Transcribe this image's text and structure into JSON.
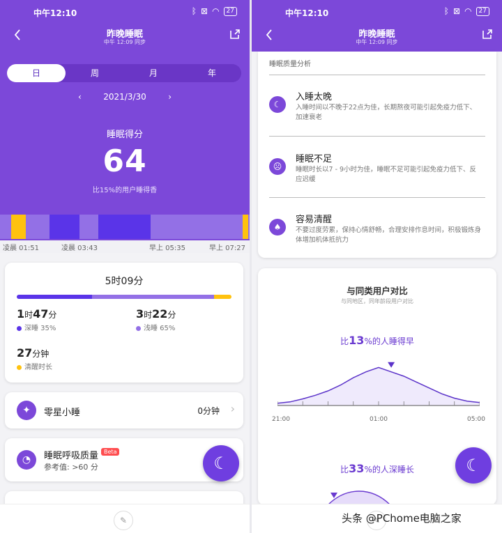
{
  "status": {
    "time": "中午12:10",
    "battery": "27"
  },
  "header": {
    "title": "昨晚睡眠",
    "subtitle": "中午 12:09 同步"
  },
  "tabs": [
    "日",
    "周",
    "月",
    "年"
  ],
  "date": "2021/3/30",
  "score": {
    "label": "睡眠得分",
    "value": "64",
    "note": "比15%的用户睡得香"
  },
  "timeline": {
    "colors": {
      "deep": "#5a34e8",
      "light": "#9370e6",
      "awake": "#ffc20e"
    },
    "segments": [
      {
        "stage": "light",
        "fraction": 0.045
      },
      {
        "stage": "awake",
        "fraction": 0.058
      },
      {
        "stage": "light",
        "fraction": 0.095
      },
      {
        "stage": "deep",
        "fraction": 0.12
      },
      {
        "stage": "light",
        "fraction": 0.075
      },
      {
        "stage": "deep",
        "fraction": 0.21
      },
      {
        "stage": "light",
        "fraction": 0.37
      },
      {
        "stage": "awake",
        "fraction": 0.022
      },
      {
        "stage": "light",
        "fraction": 0.005
      }
    ],
    "labels": [
      "凌晨 01:51",
      "凌晨 03:43",
      "早上 05:35",
      "早上 07:27"
    ]
  },
  "summary": {
    "total": "5时09分",
    "deep": {
      "h": "1",
      "hu": "时",
      "m": "47",
      "mu": "分",
      "legend": "深睡 35%"
    },
    "light": {
      "h": "3",
      "hu": "时",
      "m": "22",
      "mu": "分",
      "legend": "浅睡 65%"
    },
    "awake": {
      "m": "27",
      "mu": "分钟",
      "legend": "清醒时长"
    },
    "bar": [
      {
        "stage": "deep",
        "fraction": 0.35
      },
      {
        "stage": "light",
        "fraction": 0.57
      },
      {
        "stage": "awake",
        "fraction": 0.08
      }
    ]
  },
  "nap": {
    "label": "零星小睡",
    "value": "0分钟"
  },
  "breathing": {
    "label": "睡眠呼吸质量",
    "badge": "Beta",
    "ref": "参考值: >60 分"
  },
  "analysis": {
    "label": "睡眠质量分析",
    "items": [
      {
        "icon": "moon-icon",
        "title": "入睡太晚",
        "desc": "入睡时间以不晚于22点为佳，长期熬夜可能引起免疫力低下、加速衰老"
      },
      {
        "icon": "sad-face-icon",
        "title": "睡眠不足",
        "desc": "睡眠时长以7 - 9小时为佳，睡眠不足可能引起免疫力低下、反应迟缓"
      },
      {
        "icon": "lamp-icon",
        "title": "容易清醒",
        "desc": "不要过度劳累，保持心情舒畅，合理安排作息时间，积极锻炼身体增加机体抵抗力"
      }
    ]
  },
  "compare": {
    "title": "与同类用户对比",
    "subtitle": "与同地区，同年龄段用户对比",
    "early": {
      "prefix": "比",
      "pct": "13",
      "suffix": "%的人睡得早"
    },
    "deep": {
      "prefix": "比",
      "pct": "33",
      "suffix": "%的人深睡长"
    },
    "axis": [
      "21:00",
      "01:00",
      "05:00"
    ]
  },
  "chart_data": {
    "type": "area",
    "x": [
      "21:00",
      "21:30",
      "22:00",
      "22:30",
      "23:00",
      "23:30",
      "00:00",
      "00:30",
      "01:00",
      "01:30",
      "02:00",
      "02:30",
      "03:00",
      "03:30",
      "04:00",
      "04:30",
      "05:00"
    ],
    "values": [
      3,
      5,
      9,
      14,
      20,
      28,
      38,
      46,
      52,
      46,
      40,
      32,
      24,
      16,
      10,
      6,
      4
    ],
    "marker_x": "01:30"
  },
  "watermark": "头条 @PChome电脑之家"
}
